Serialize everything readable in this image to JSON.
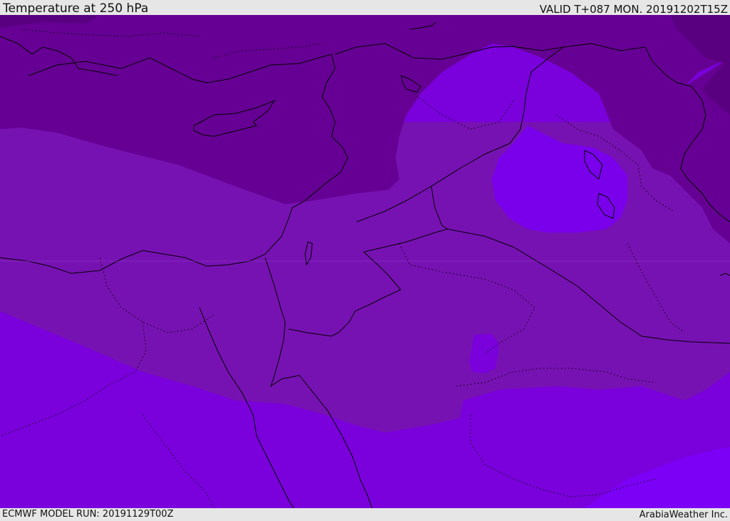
{
  "header": {
    "title": "Temperature at 250 hPa",
    "valid": "VALID T+087 MON. 20191202T15Z"
  },
  "footer": {
    "model_run": "ECMWF MODEL RUN: 20191129T00Z",
    "brand": "ArabiaWeather Inc."
  },
  "map": {
    "colors": {
      "coldest": "#580080",
      "cold": "#660094",
      "mid": "#7712b2",
      "warm": "#7a00dc",
      "warmest": "#7c00f6",
      "coast": "#000000"
    }
  }
}
